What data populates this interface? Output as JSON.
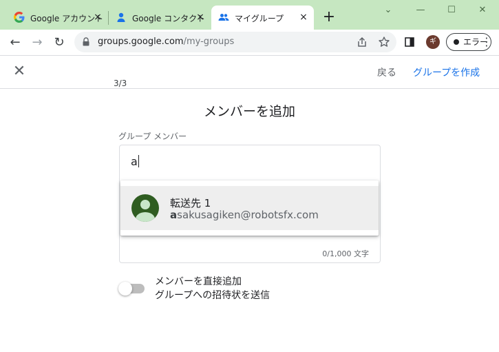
{
  "browser": {
    "tabs": [
      {
        "title": "Google アカウント",
        "close": "×",
        "favicon": "google-g-icon"
      },
      {
        "title": "Google コンタクト",
        "close": "×",
        "favicon": "contacts-icon"
      },
      {
        "title": "マイグループ",
        "close": "×",
        "favicon": "groups-icon"
      }
    ],
    "new_tab": "+",
    "window_controls": {
      "minimize": "—",
      "maximize": "☐",
      "close": "✕",
      "chevron": "⌄"
    },
    "nav": {
      "back": "←",
      "forward": "→",
      "reload": "↻"
    },
    "address": {
      "host": "groups.google.com",
      "path": "/my-groups"
    },
    "profile_initial": "ギ",
    "error_label": "エラー",
    "menu": "⋮",
    "colors": {
      "tabstrip": "#c6e7c1",
      "active_tab": "#ffffff"
    }
  },
  "page": {
    "close": "✕",
    "back_label": "戻る",
    "create_label": "グループを作成",
    "step": "3/3",
    "heading": "メンバーを追加",
    "field_label": "グループ メンバー",
    "input_value": "a",
    "counter": "0/1,000 文字",
    "suggestion": {
      "name": "転送先 1",
      "email_match": "a",
      "email_rest": "sakusagiken@robotsfx.com",
      "avatar_color": "#2f5d21"
    },
    "toggle": {
      "label_line1": "メンバーを直接追加",
      "label_line2": "グループへの招待状を送信",
      "on": false
    },
    "colors": {
      "link": "#1a73e8",
      "divider": "#dadce0"
    }
  }
}
